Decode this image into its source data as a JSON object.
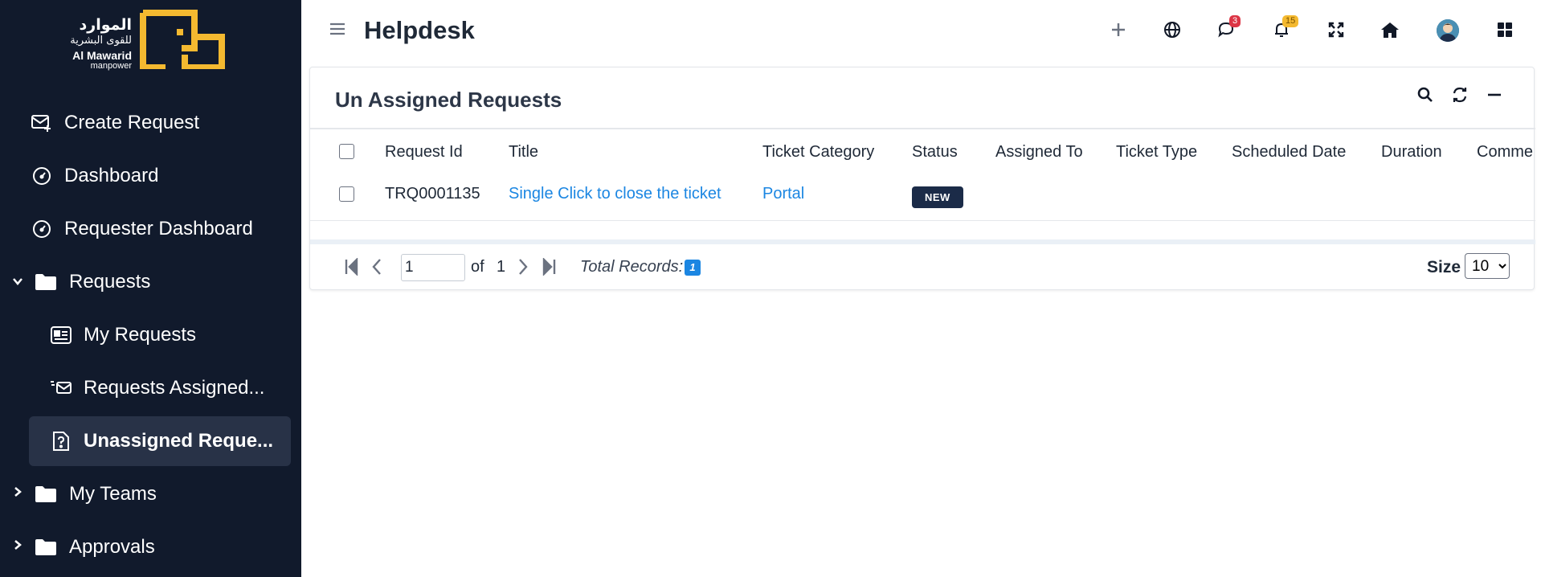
{
  "brand": {
    "arabic_line1": "الموارد",
    "arabic_line2": "للقوى البشرية",
    "english_line1": "Al Mawarid",
    "english_line2": "manpower",
    "accent_color": "#f4b930"
  },
  "sidebar": {
    "items": [
      {
        "label": "Create Request",
        "icon": "mail-plus-icon"
      },
      {
        "label": "Dashboard",
        "icon": "gauge-icon"
      },
      {
        "label": "Requester Dashboard",
        "icon": "gauge-icon"
      },
      {
        "label": "Requests",
        "icon": "folder-icon",
        "expanded": true
      },
      {
        "label": "My Requests",
        "icon": "id-card-icon"
      },
      {
        "label": "Requests Assigned...",
        "icon": "mail-fast-icon"
      },
      {
        "label": "Unassigned Reque...",
        "icon": "file-question-icon",
        "active": true
      },
      {
        "label": "My Teams",
        "icon": "folder-icon",
        "expanded": false
      },
      {
        "label": "Approvals",
        "icon": "folder-icon",
        "expanded": false
      }
    ]
  },
  "topbar": {
    "title": "Helpdesk",
    "messages_count": "3",
    "notifications_count": "15"
  },
  "card": {
    "title": "Un Assigned Requests",
    "columns": [
      "Request Id",
      "Title",
      "Ticket Category",
      "Status",
      "Assigned To",
      "Ticket Type",
      "Scheduled Date",
      "Duration",
      "Comme"
    ],
    "rows": [
      {
        "request_id": "TRQ0001135",
        "title": "Single Click to close the ticket",
        "ticket_category": "Portal",
        "status": "NEW"
      }
    ]
  },
  "pager": {
    "page": "1",
    "of_label": "of",
    "total_pages": "1",
    "total_records_label": "Total Records:",
    "total_records": "1",
    "size_label": "Size",
    "size_value": "10"
  },
  "colors": {
    "sidebar_bg": "#111a2c",
    "active_item_bg": "#283247",
    "link": "#1b86e2",
    "status_new_bg": "#1b2b48",
    "message_badge": "#dc3545",
    "notification_badge": "#f4b930"
  }
}
